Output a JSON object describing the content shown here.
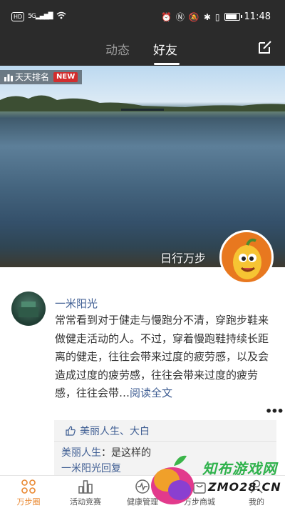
{
  "status_bar": {
    "left_badge": "HD",
    "network": "5G",
    "time": "11:48"
  },
  "header": {
    "tabs": [
      {
        "label": "动态",
        "active": false
      },
      {
        "label": "好友",
        "active": true
      }
    ]
  },
  "banner": {
    "rank_label": "天天排名",
    "new_tag": "NEW",
    "caption": "日行万步"
  },
  "post": {
    "username": "一米阳光",
    "content": "常常看到对于健走与慢跑分不清，穿跑步鞋来做健走活动的人。不过，穿着慢跑鞋持续长距离的健走，往往会带来过度的疲劳感，以及会造成过度的疲劳感，往往会带来过度的疲劳感，往往会带…",
    "read_more": "阅读全文",
    "likes": "美丽人生、大白",
    "comment_author": "美丽人生",
    "comment_text": "是这样的",
    "comment2_visible": "一米阳光回复"
  },
  "bottom_nav": {
    "items": [
      {
        "label": "万步圈",
        "active": true
      },
      {
        "label": "活动竞赛",
        "active": false
      },
      {
        "label": "健康管理",
        "active": false
      },
      {
        "label": "万步商城",
        "active": false
      },
      {
        "label": "我的",
        "active": false
      }
    ]
  },
  "watermark": {
    "title": "知布游戏网",
    "url": "ZMO28.CN"
  },
  "colors": {
    "accent": "#e9872f",
    "link_blue": "#3f5e93",
    "header_bg": "#2b2b2b",
    "new_red": "#d32d2d"
  },
  "icons": [
    "hd-icon",
    "signal-icon",
    "wifi-icon",
    "nfc-icon",
    "bluetooth-icon",
    "battery-icon",
    "edit-icon",
    "rank-chart-icon",
    "thumb-up-icon",
    "more-dots-icon",
    "circle-icon",
    "competition-icon",
    "health-icon",
    "shop-icon",
    "profile-icon"
  ]
}
